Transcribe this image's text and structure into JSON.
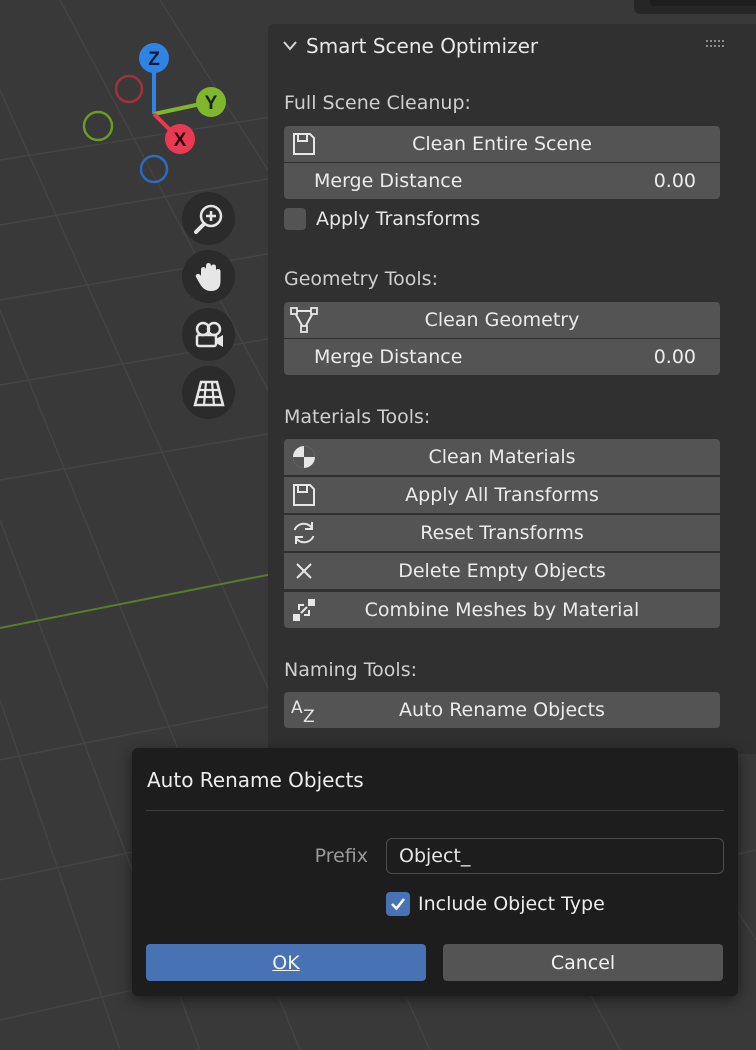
{
  "panel": {
    "title": "Smart Scene Optimizer",
    "sections": {
      "full_scene": {
        "label": "Full Scene Cleanup:",
        "clean_button": "Clean Entire Scene",
        "merge_label": "Merge Distance",
        "merge_value": "0.00",
        "apply_transforms_label": "Apply Transforms",
        "apply_transforms_checked": false
      },
      "geometry": {
        "label": "Geometry Tools:",
        "clean_button": "Clean Geometry",
        "merge_label": "Merge Distance",
        "merge_value": "0.00"
      },
      "materials": {
        "label": "Materials Tools:",
        "buttons": [
          {
            "label": "Clean Materials",
            "icon": "material-icon"
          },
          {
            "label": "Apply All Transforms",
            "icon": "save-icon"
          },
          {
            "label": "Reset Transforms",
            "icon": "refresh-icon"
          },
          {
            "label": "Delete Empty Objects",
            "icon": "x-icon"
          },
          {
            "label": "Combine Meshes by Material",
            "icon": "link-icon"
          }
        ]
      },
      "naming": {
        "label": "Naming Tools:",
        "rename_button": "Auto Rename Objects"
      }
    }
  },
  "gizmo": {
    "axes": {
      "x": "X",
      "y": "Y",
      "z": "Z"
    },
    "colors": {
      "x": "#e83a52",
      "y": "#7fb62b",
      "z": "#2f84e3"
    }
  },
  "dialog": {
    "title": "Auto Rename Objects",
    "prefix_label": "Prefix",
    "prefix_value": "Object_",
    "include_type_label": "Include Object Type",
    "include_type_checked": true,
    "ok_label": "OK",
    "cancel_label": "Cancel"
  },
  "colors": {
    "viewport_bg": "#393939",
    "panel_bg": "#303030",
    "button_bg": "#545454",
    "accent": "#4772b3",
    "dialog_bg": "#1d1d1d"
  }
}
